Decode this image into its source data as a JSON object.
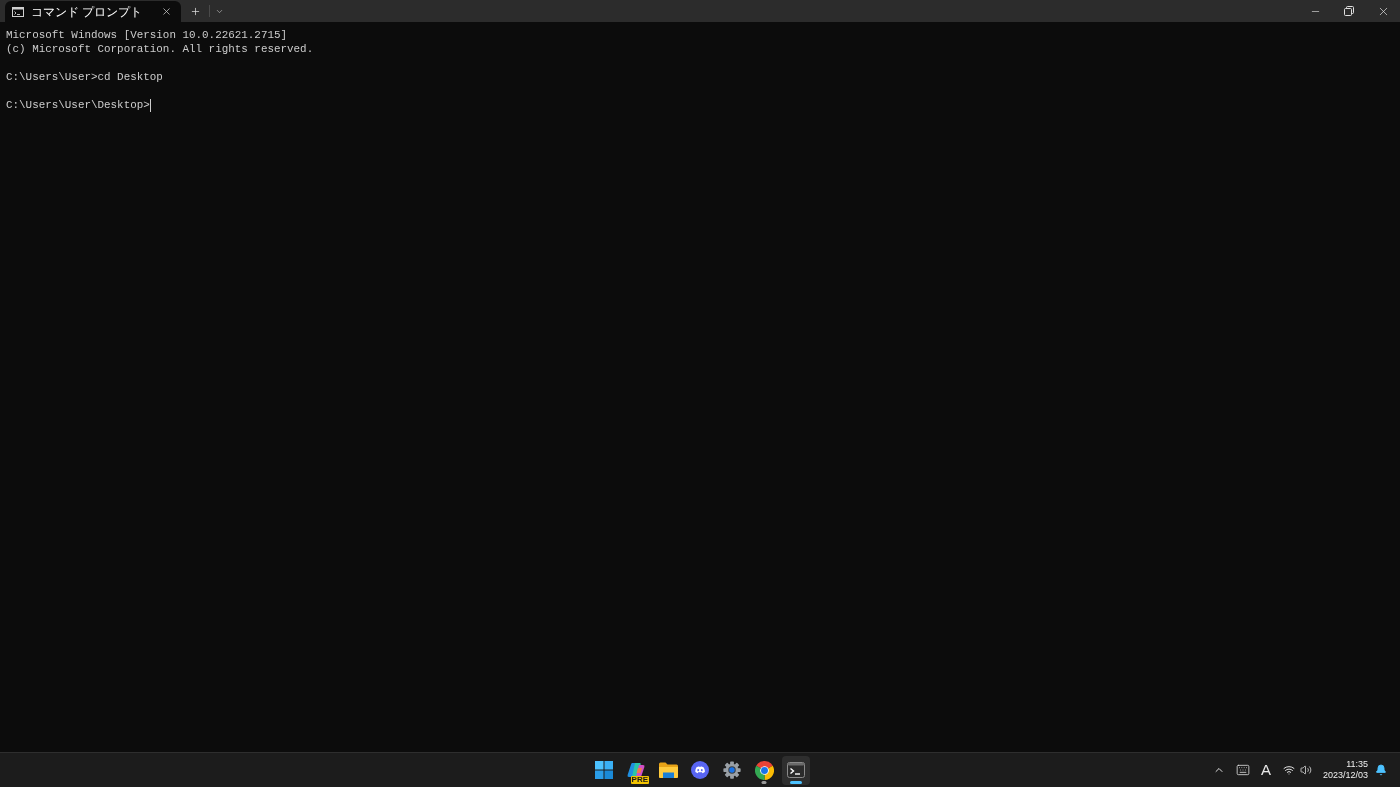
{
  "window": {
    "tabs": [
      {
        "title": "コマンド プロンプト",
        "selected": true
      }
    ]
  },
  "terminal": {
    "blocks": [
      [
        "Microsoft Windows [Version 10.0.22621.2715]",
        "(c) Microsoft Corporation. All rights reserved."
      ],
      [
        "C:\\Users\\User>cd Desktop"
      ],
      [
        "C:\\Users\\User\\Desktop>"
      ]
    ],
    "cursor_visible": true
  },
  "taskbar": {
    "apps": [
      {
        "kind": "start",
        "running": false,
        "active": false
      },
      {
        "kind": "copilot",
        "badge": "PRE",
        "running": false,
        "active": false
      },
      {
        "kind": "explorer",
        "running": false,
        "active": false
      },
      {
        "kind": "discord",
        "running": false,
        "active": false
      },
      {
        "kind": "settings",
        "running": false,
        "active": false
      },
      {
        "kind": "chrome",
        "running": true,
        "active": false
      },
      {
        "kind": "terminal",
        "running": true,
        "active": true
      }
    ],
    "tray": {
      "ime_mode": "A",
      "time": "11:35",
      "date": "2023/12/03"
    }
  }
}
